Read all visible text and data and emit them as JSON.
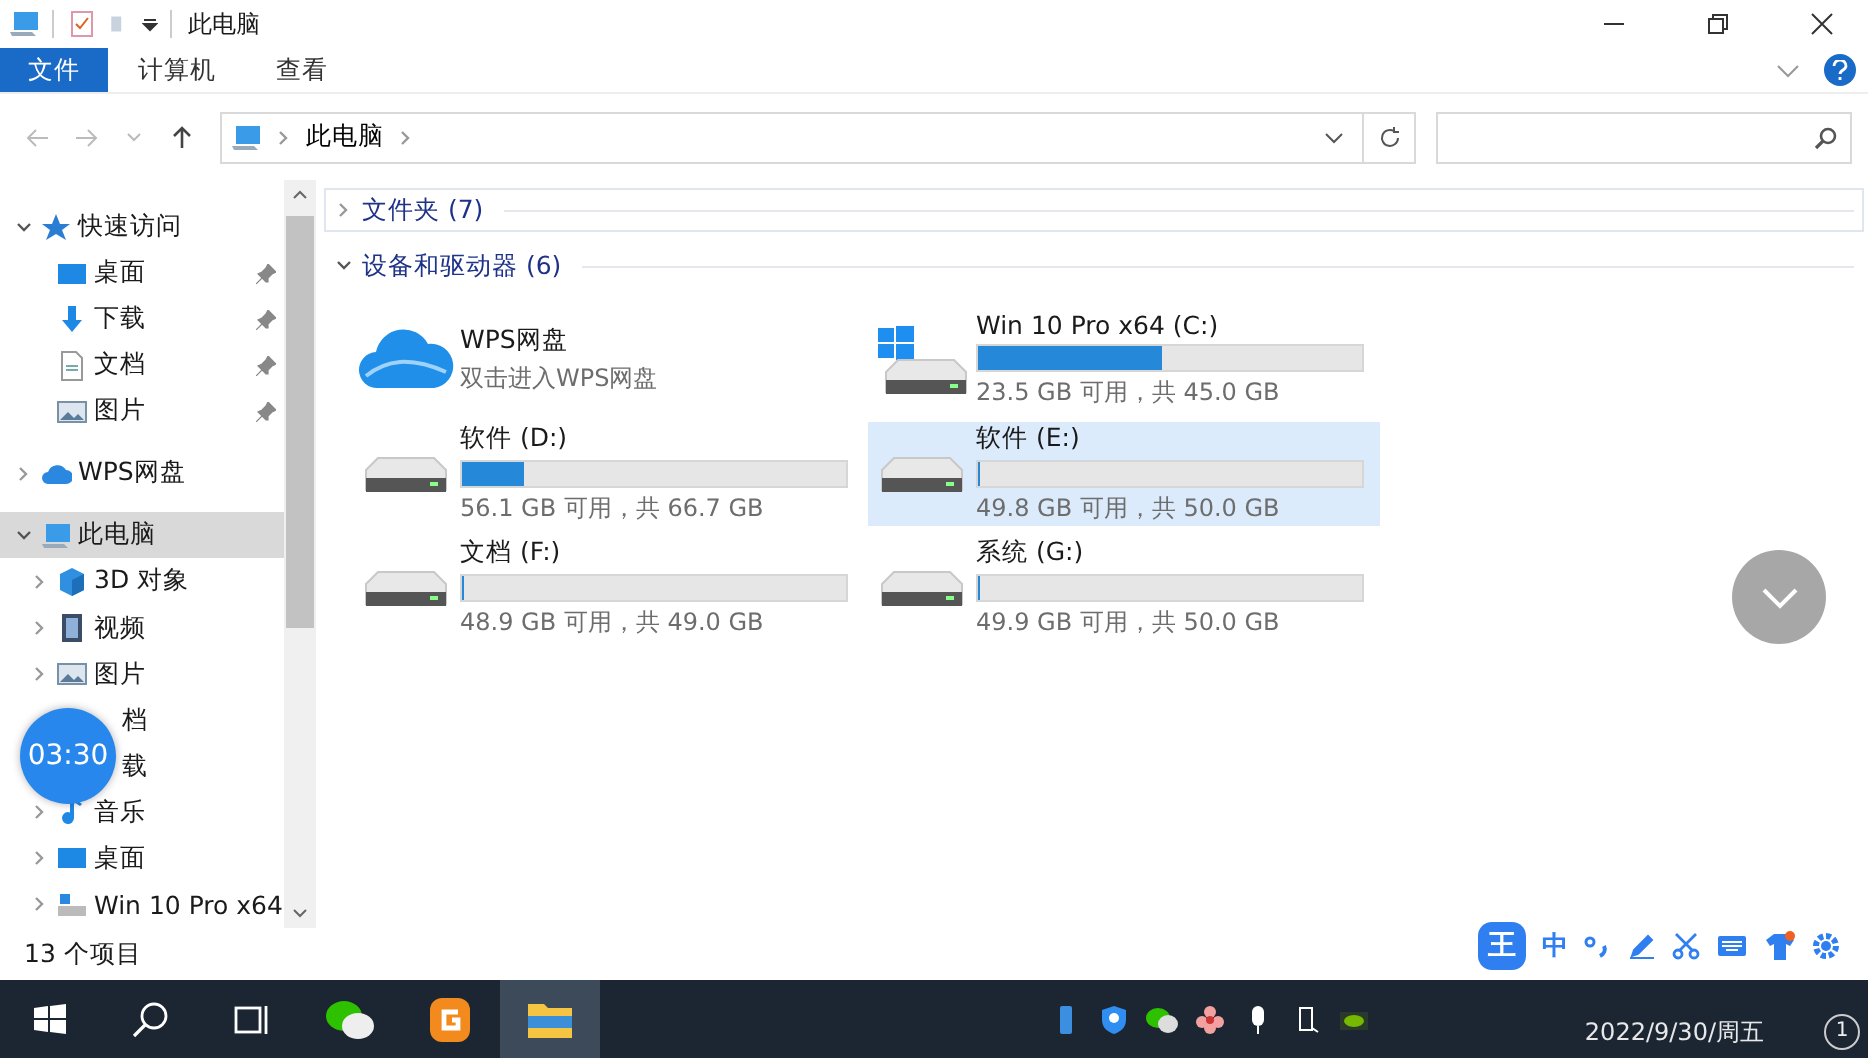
{
  "window": {
    "title": "此电脑"
  },
  "ribbon": {
    "tabs": [
      {
        "label": "文件",
        "selected": true
      },
      {
        "label": "计算机",
        "selected": false
      },
      {
        "label": "查看",
        "selected": false
      }
    ]
  },
  "address_bar": {
    "path": [
      "此电脑"
    ]
  },
  "sidebar": {
    "items": [
      {
        "label": "快速访问",
        "kind": "star",
        "expanded": true,
        "selected": false,
        "children": [
          {
            "label": "桌面",
            "kind": "desktop",
            "pinned": true,
            "selected": false
          },
          {
            "label": "下载",
            "kind": "download",
            "pinned": true,
            "selected": false
          },
          {
            "label": "文档",
            "kind": "document",
            "pinned": true,
            "selected": false
          },
          {
            "label": "图片",
            "kind": "picture",
            "pinned": true,
            "selected": false
          }
        ]
      },
      {
        "label": "WPS网盘",
        "kind": "cloud",
        "expanded": false,
        "selected": false
      },
      {
        "label": "此电脑",
        "kind": "computer",
        "expanded": true,
        "selected": true,
        "children": [
          {
            "label": "3D 对象",
            "kind": "cube",
            "expanded": false,
            "selected": false
          },
          {
            "label": "视频",
            "kind": "video",
            "expanded": false,
            "selected": false
          },
          {
            "label": "图片",
            "kind": "picture",
            "expanded": false,
            "selected": false
          },
          {
            "label": "档",
            "kind": "covered",
            "selected": false
          },
          {
            "label": "载",
            "kind": "covered",
            "selected": false
          },
          {
            "label": "音乐",
            "kind": "music",
            "expanded": false,
            "selected": false
          },
          {
            "label": "桌面",
            "kind": "desktop",
            "expanded": false,
            "selected": false
          },
          {
            "label": "Win 10 Pro x64",
            "kind": "drive",
            "expanded": false,
            "selected": false
          }
        ]
      }
    ]
  },
  "sections": [
    {
      "title": "文件夹 (7)",
      "expanded": false
    },
    {
      "title": "设备和驱动器 (6)",
      "expanded": true,
      "items": [
        {
          "kind": "cloud",
          "name": "WPS网盘",
          "subtitle": "双击进入WPS网盘",
          "selected": false
        },
        {
          "kind": "system",
          "name": "Win 10 Pro x64 (C:)",
          "level": 0.48,
          "free": "23.5 GB 可用，共 45.0 GB",
          "selected": false
        },
        {
          "kind": "drive",
          "name": "软件 (D:)",
          "level": 0.16,
          "free": "56.1 GB 可用，共 66.7 GB",
          "selected": false
        },
        {
          "kind": "drive",
          "name": "软件 (E:)",
          "level": 0.004,
          "free": "49.8 GB 可用，共 50.0 GB",
          "selected": true
        },
        {
          "kind": "drive",
          "name": "文档 (F:)",
          "level": 0.002,
          "free": "48.9 GB 可用，共 49.0 GB",
          "selected": false
        },
        {
          "kind": "drive",
          "name": "系统 (G:)",
          "level": 0.002,
          "free": "49.9 GB 可用，共 50.0 GB",
          "selected": false
        }
      ]
    }
  ],
  "status_bar": {
    "item_count": "13 个项目"
  },
  "timer_badge": "03:30",
  "ime_toolbar": {
    "logo": "王",
    "mode": "中"
  },
  "taskbar": {
    "apps": [
      {
        "kind": "chat",
        "active": false
      },
      {
        "kind": "g-app",
        "active": false
      },
      {
        "kind": "folder",
        "active": true
      }
    ],
    "date": "2022/9/30/周五",
    "notification_count": "1"
  }
}
